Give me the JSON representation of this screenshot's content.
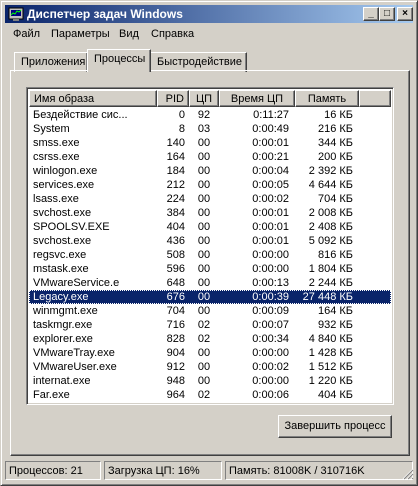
{
  "window": {
    "title": "Диспетчер задач Windows",
    "minimize": "_",
    "maximize": "□",
    "close": "×"
  },
  "menu": [
    "Файл",
    "Параметры",
    "Вид",
    "Справка"
  ],
  "tabs": [
    "Приложения",
    "Процессы",
    "Быстродействие"
  ],
  "active_tab": 1,
  "columns": [
    "Имя образа",
    "PID",
    "ЦП",
    "Время ЦП",
    "Память"
  ],
  "processes": [
    {
      "name": "Бездействие сис...",
      "pid": "0",
      "cpu": "92",
      "time": "0:11:27",
      "mem": "16 КБ"
    },
    {
      "name": "System",
      "pid": "8",
      "cpu": "03",
      "time": "0:00:49",
      "mem": "216 КБ"
    },
    {
      "name": "smss.exe",
      "pid": "140",
      "cpu": "00",
      "time": "0:00:01",
      "mem": "344 КБ"
    },
    {
      "name": "csrss.exe",
      "pid": "164",
      "cpu": "00",
      "time": "0:00:21",
      "mem": "200 КБ"
    },
    {
      "name": "winlogon.exe",
      "pid": "184",
      "cpu": "00",
      "time": "0:00:04",
      "mem": "2 392 КБ"
    },
    {
      "name": "services.exe",
      "pid": "212",
      "cpu": "00",
      "time": "0:00:05",
      "mem": "4 644 КБ"
    },
    {
      "name": "lsass.exe",
      "pid": "224",
      "cpu": "00",
      "time": "0:00:02",
      "mem": "704 КБ"
    },
    {
      "name": "svchost.exe",
      "pid": "384",
      "cpu": "00",
      "time": "0:00:01",
      "mem": "2 008 КБ"
    },
    {
      "name": "SPOOLSV.EXE",
      "pid": "404",
      "cpu": "00",
      "time": "0:00:01",
      "mem": "2 408 КБ"
    },
    {
      "name": "svchost.exe",
      "pid": "436",
      "cpu": "00",
      "time": "0:00:01",
      "mem": "5 092 КБ"
    },
    {
      "name": "regsvc.exe",
      "pid": "508",
      "cpu": "00",
      "time": "0:00:00",
      "mem": "816 КБ"
    },
    {
      "name": "mstask.exe",
      "pid": "596",
      "cpu": "00",
      "time": "0:00:00",
      "mem": "1 804 КБ"
    },
    {
      "name": "VMwareService.e",
      "pid": "648",
      "cpu": "00",
      "time": "0:00:13",
      "mem": "2 244 КБ"
    },
    {
      "name": "Legacy.exe",
      "pid": "676",
      "cpu": "00",
      "time": "0:00:39",
      "mem": "27 448 КБ"
    },
    {
      "name": "winmgmt.exe",
      "pid": "704",
      "cpu": "00",
      "time": "0:00:09",
      "mem": "164 КБ"
    },
    {
      "name": "taskmgr.exe",
      "pid": "716",
      "cpu": "02",
      "time": "0:00:07",
      "mem": "932 КБ"
    },
    {
      "name": "explorer.exe",
      "pid": "828",
      "cpu": "02",
      "time": "0:00:34",
      "mem": "4 840 КБ"
    },
    {
      "name": "VMwareTray.exe",
      "pid": "904",
      "cpu": "00",
      "time": "0:00:00",
      "mem": "1 428 КБ"
    },
    {
      "name": "VMwareUser.exe",
      "pid": "912",
      "cpu": "00",
      "time": "0:00:02",
      "mem": "1 512 КБ"
    },
    {
      "name": "internat.exe",
      "pid": "948",
      "cpu": "00",
      "time": "0:00:00",
      "mem": "1 220 КБ"
    },
    {
      "name": "Far.exe",
      "pid": "964",
      "cpu": "02",
      "time": "0:00:06",
      "mem": "404 КБ"
    }
  ],
  "selected_process": "Legacy.exe",
  "end_process_button": "Завершить процесс",
  "status": {
    "processes": "Процессов: 21",
    "cpu": "Загрузка ЦП: 16%",
    "memory": "Память: 81008K / 310716K"
  },
  "colors": {
    "title_active": "#0a246a",
    "selection": "#0a246a",
    "face": "#d4d0c8"
  },
  "icons": {
    "app": "task-manager-icon",
    "grip": "resize-grip-icon"
  }
}
